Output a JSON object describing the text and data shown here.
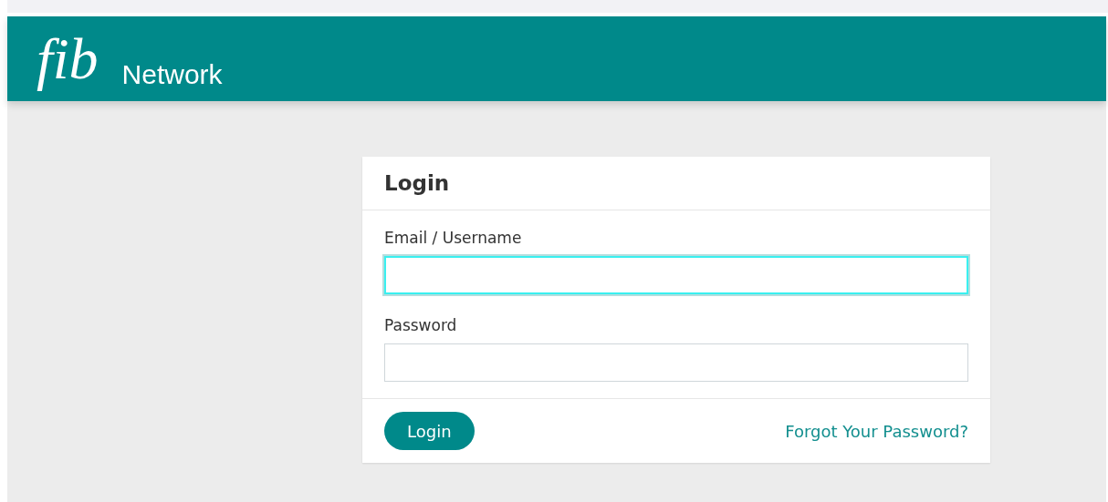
{
  "header": {
    "logo_mark": "fib",
    "logo_text": "Network"
  },
  "login_card": {
    "title": "Login",
    "fields": [
      {
        "label": "Email / Username",
        "focused": true
      },
      {
        "label": "Password",
        "focused": false
      }
    ],
    "submit_button": "Login",
    "forgot_link": "Forgot Your Password?"
  }
}
